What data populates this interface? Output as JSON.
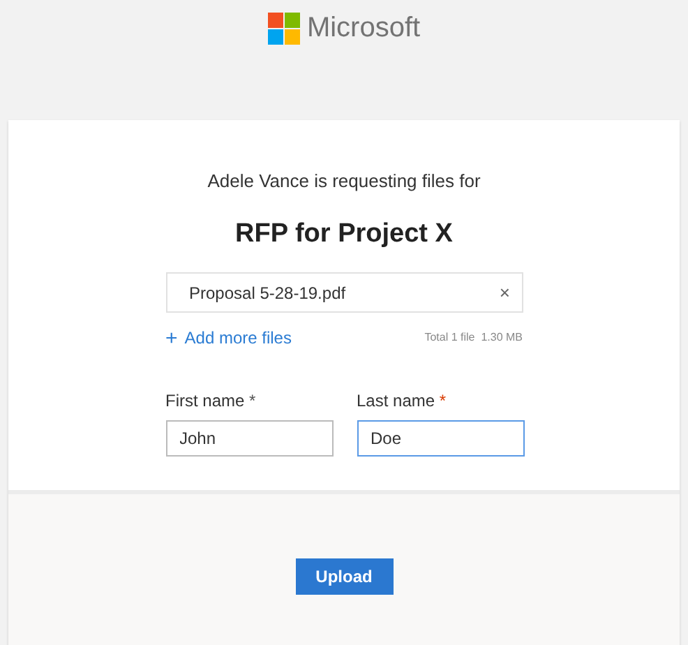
{
  "brand": {
    "name": "Microsoft"
  },
  "request": {
    "intro": "Adele Vance is requesting files for",
    "title": "RFP for Project X"
  },
  "files": [
    {
      "name": "Proposal 5-28-19.pdf",
      "remove": "×"
    }
  ],
  "add_files": {
    "icon": "+",
    "label": "Add more files"
  },
  "total": "Total 1 file  1.30 MB",
  "fields": [
    {
      "label": "First name",
      "required": "*",
      "value": "John",
      "focused": false
    },
    {
      "label": "Last name",
      "required": "*",
      "value": "Doe",
      "focused": true
    }
  ],
  "submit": "Upload"
}
